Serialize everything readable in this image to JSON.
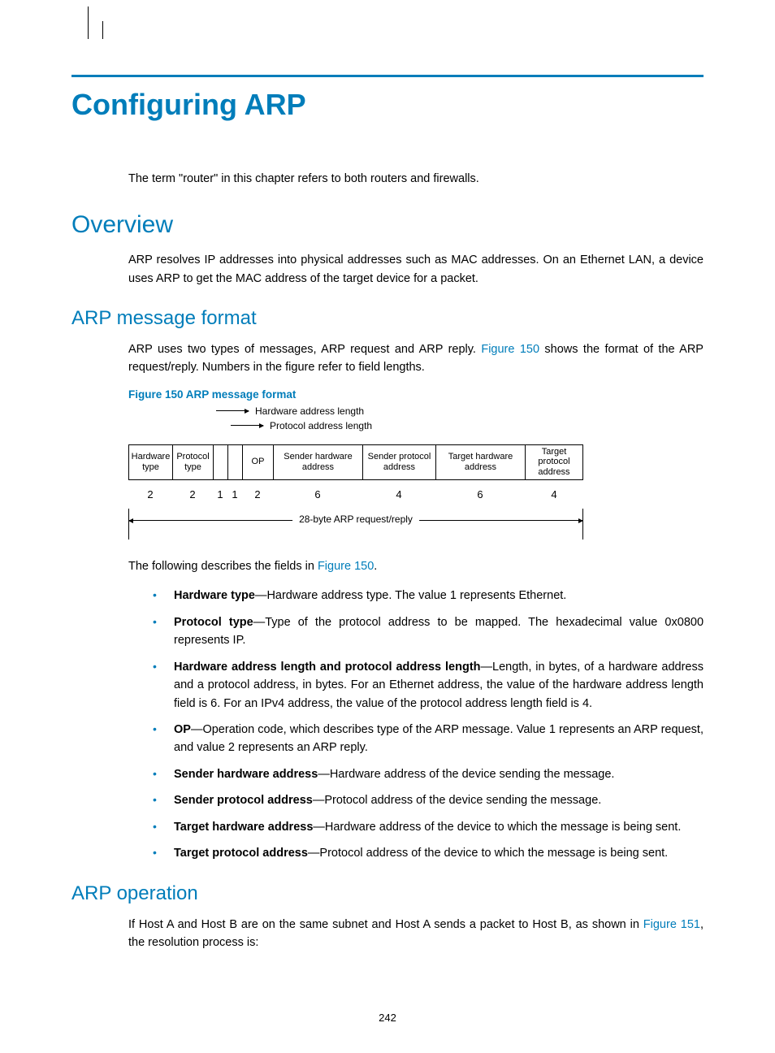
{
  "title": "Configuring ARP",
  "intro": "The term \"router\" in this chapter refers to both routers and firewalls.",
  "sections": {
    "overview": {
      "heading": "Overview",
      "p1": "ARP resolves IP addresses into physical addresses such as MAC addresses. On an Ethernet LAN, a device uses ARP to get the MAC address of the target device for a packet."
    },
    "msgfmt": {
      "heading": "ARP message format",
      "p1a": "ARP uses two types of messages, ARP request and ARP reply. ",
      "p1_link": "Figure 150",
      "p1b": " shows the format of the ARP request/reply. Numbers in the figure refer to field lengths.",
      "caption": "Figure 150 ARP message format",
      "p2a": "The following describes the fields in ",
      "p2_link": "Figure 150",
      "p2b": ".",
      "bullets": [
        {
          "term": "Hardware type",
          "rest": "—Hardware address type. The value 1 represents Ethernet."
        },
        {
          "term": "Protocol type",
          "rest": "—Type of the protocol address to be mapped. The hexadecimal value 0x0800 represents IP."
        },
        {
          "term": "Hardware address length and protocol address length",
          "rest": "—Length, in bytes, of a hardware address and a protocol address, in bytes. For an Ethernet address, the value of the hardware address length field is 6. For an IPv4 address, the value of the protocol address length field is 4."
        },
        {
          "term": "OP",
          "rest": "—Operation code, which describes type of the ARP message. Value 1 represents an ARP request, and value 2 represents an ARP reply."
        },
        {
          "term": "Sender hardware address",
          "rest": "—Hardware address of the device sending the message."
        },
        {
          "term": "Sender protocol address",
          "rest": "—Protocol address of the device sending the message."
        },
        {
          "term": "Target hardware address",
          "rest": "—Hardware address of the device to which the message is being sent."
        },
        {
          "term": "Target protocol address",
          "rest": "—Protocol address of the device to which the message is being sent."
        }
      ]
    },
    "operation": {
      "heading": "ARP operation",
      "p1a": "If Host A and Host B are on the same subnet and Host A sends a packet to Host B, as shown in ",
      "p1_link": "Figure 151",
      "p1b": ", the resolution process is:"
    }
  },
  "diagram": {
    "arrow1": "Hardware address length",
    "arrow2": "Protocol address length",
    "fields": {
      "hw": "Hardware type",
      "pt": "Protocol type",
      "op": "OP",
      "sha": "Sender hardware address",
      "spa": "Sender protocol address",
      "tha": "Target hardware address",
      "tpa": "Target protocol address"
    },
    "lengths": {
      "hw": "2",
      "pt": "2",
      "a1": "1",
      "a2": "1",
      "op": "2",
      "sha": "6",
      "spa": "4",
      "tha": "6",
      "tpa": "4"
    },
    "dim": "28-byte ARP request/reply"
  },
  "page_number": "242"
}
